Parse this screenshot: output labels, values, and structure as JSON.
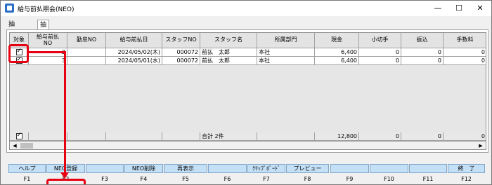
{
  "window": {
    "title": "給与前払照会(NEO)",
    "controls": {
      "minimize": "—",
      "maximize": "☐",
      "close": "✕"
    }
  },
  "tabs": [
    {
      "label": "抽出条件",
      "active": false
    },
    {
      "label": "抽出結果",
      "active": true
    }
  ],
  "grid": {
    "headers": [
      "対象",
      "給与前払\nNO",
      "勤怠NO",
      "給与前払日",
      "スタッフNO",
      "スタッフ名",
      "所属部門",
      "現金",
      "小切手",
      "振込",
      "手数料"
    ],
    "rows": [
      {
        "checked": true,
        "no": "2",
        "kintai": "",
        "date": "2024/05/02(木)",
        "staff_no": "000072",
        "staff_name": "前払　太郎",
        "dept": "本社",
        "cash": "6,400",
        "check": "0",
        "transfer": "0",
        "fee": "0"
      },
      {
        "checked": true,
        "no": "3",
        "kintai": "",
        "date": "2024/05/01(水)",
        "staff_no": "000072",
        "staff_name": "前払　太郎",
        "dept": "本社",
        "cash": "6,400",
        "check": "0",
        "transfer": "0",
        "fee": "0"
      }
    ],
    "totals": {
      "label": "合計 2件",
      "cash": "12,800",
      "check": "0",
      "transfer": "0",
      "fee": "0"
    }
  },
  "function_keys": [
    {
      "label": "ヘルプ",
      "key": "F1"
    },
    {
      "label": "NEO登録",
      "key": "F2"
    },
    {
      "label": "",
      "key": "F3"
    },
    {
      "label": "NEO削除",
      "key": "F4"
    },
    {
      "label": "再表示",
      "key": "F5"
    },
    {
      "label": "",
      "key": "F6"
    },
    {
      "label": "ｸﾘｯﾌﾟﾎﾞｰﾄﾞ",
      "key": "F7"
    },
    {
      "label": "プレビュー",
      "key": "F8"
    },
    {
      "label": "",
      "key": "F9"
    },
    {
      "label": "",
      "key": "F10"
    },
    {
      "label": "",
      "key": "F11"
    },
    {
      "label": "終　了",
      "key": "F12"
    }
  ],
  "colors": {
    "highlight": "#e60012",
    "fkey_bg": "#c4e0f7"
  }
}
